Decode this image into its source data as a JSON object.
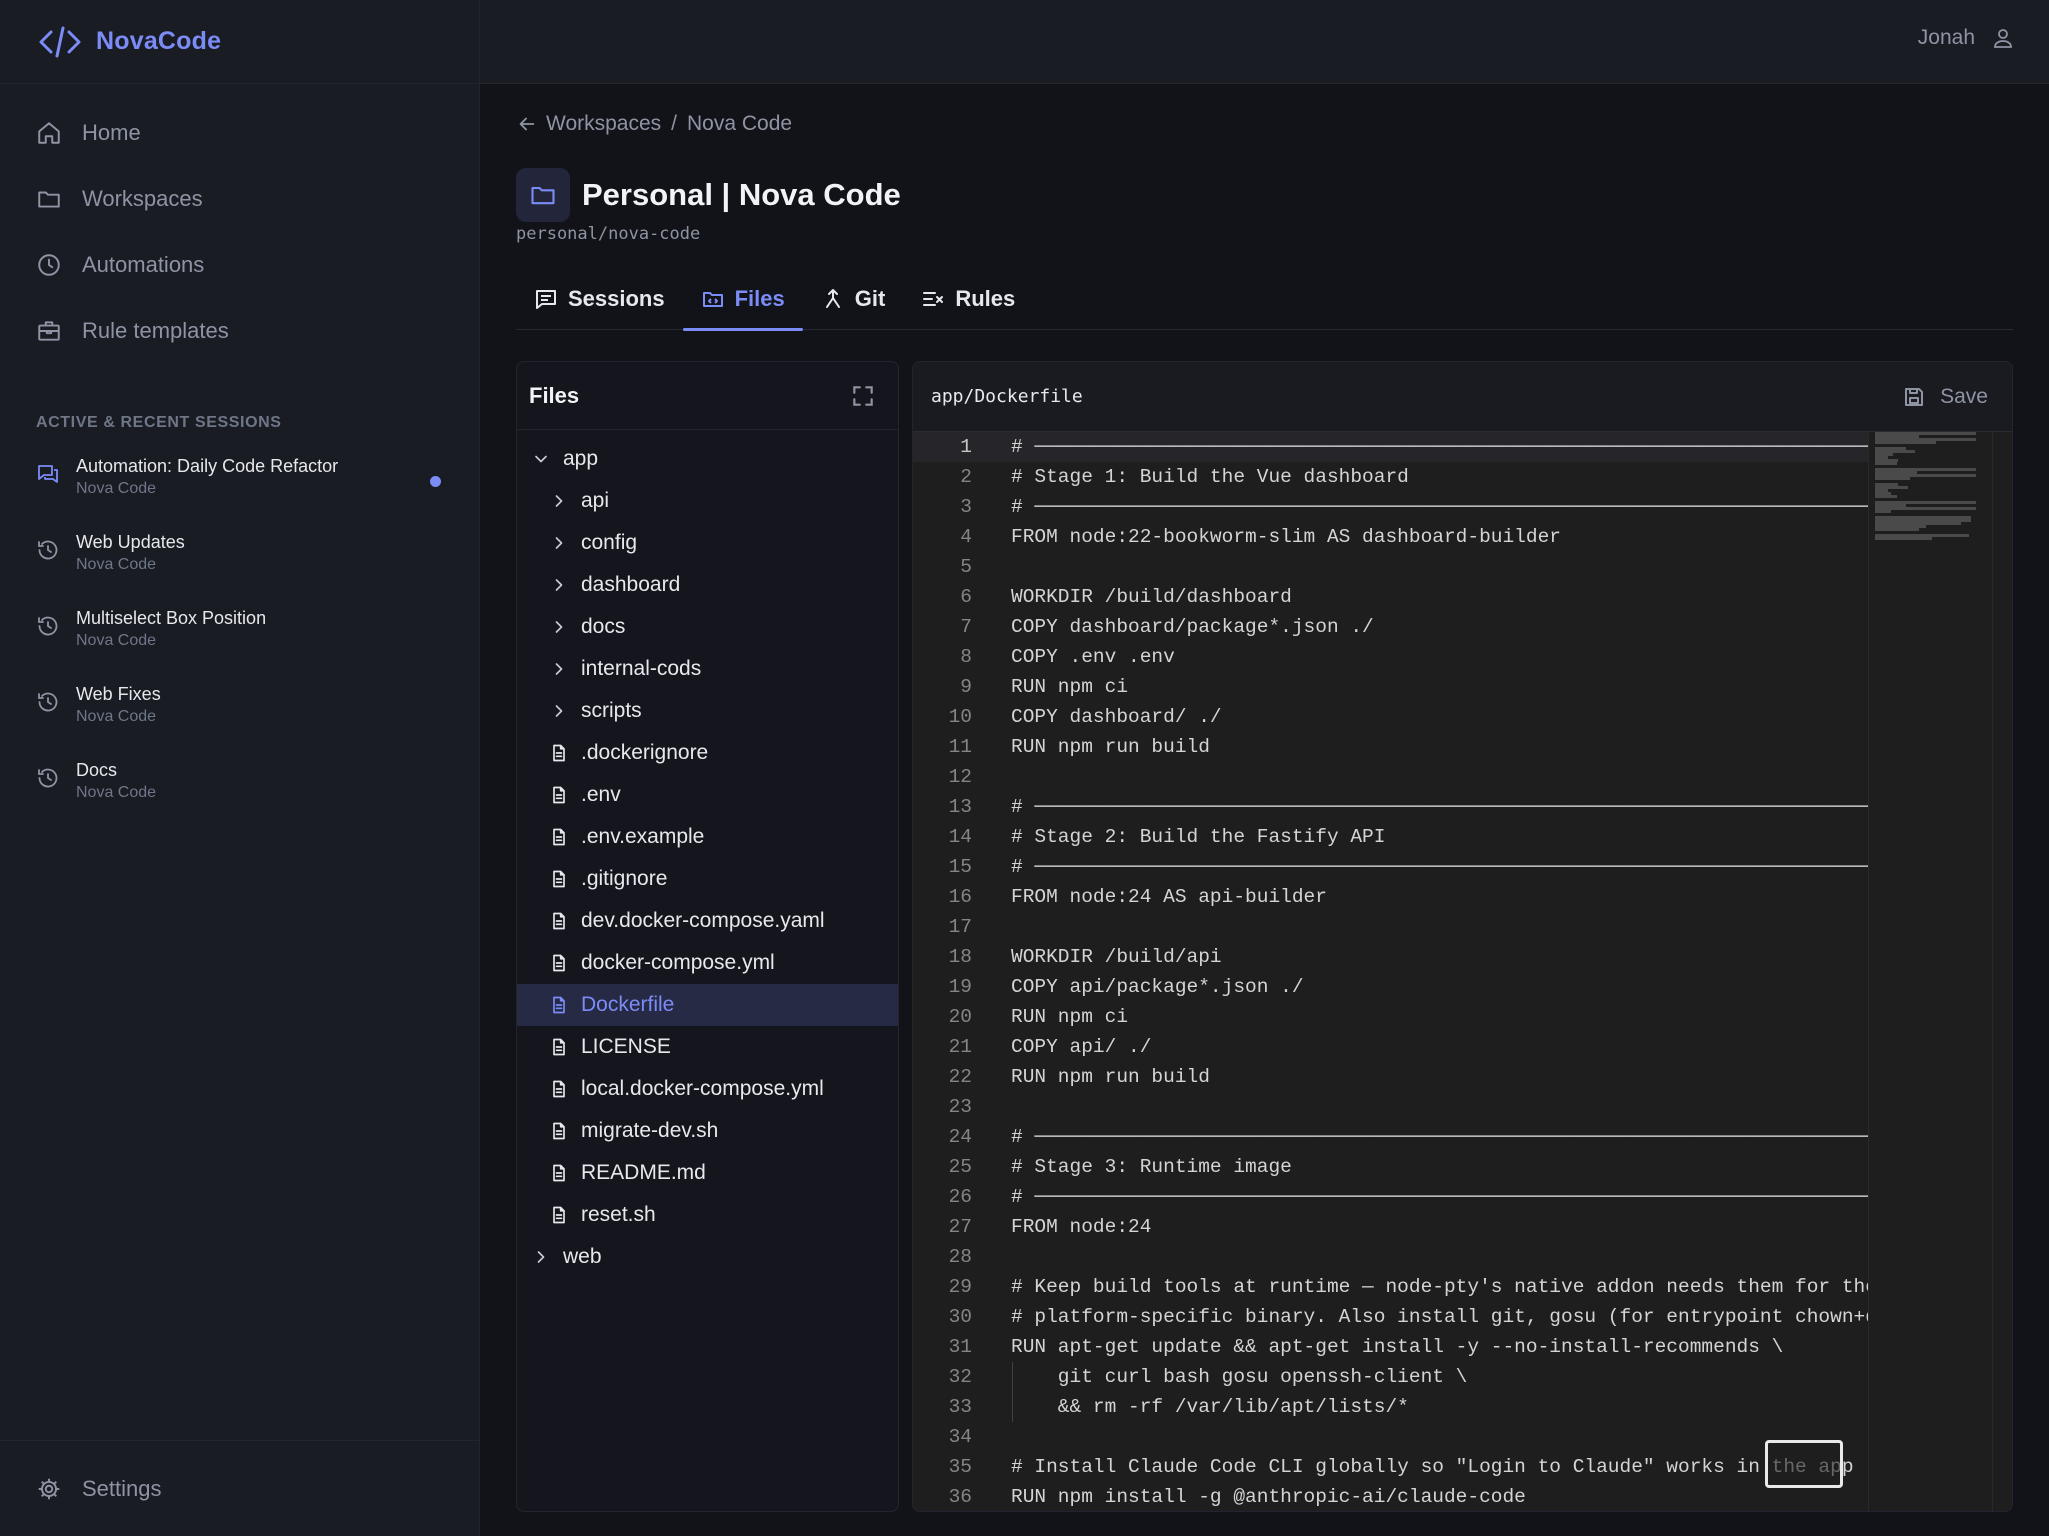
{
  "app": {
    "name": "NovaCode"
  },
  "sidebar": {
    "nav": [
      {
        "label": "Home",
        "icon": "home-icon"
      },
      {
        "label": "Workspaces",
        "icon": "folder-icon"
      },
      {
        "label": "Automations",
        "icon": "clock-icon"
      },
      {
        "label": "Rule templates",
        "icon": "briefcase-icon"
      }
    ],
    "sessions_label": "ACTIVE & RECENT SESSIONS",
    "sessions": [
      {
        "title": "Automation: Daily Code Refactor",
        "sub": "Nova Code",
        "icon": "chat-icon",
        "active": true
      },
      {
        "title": "Web Updates",
        "sub": "Nova Code",
        "icon": "history-icon"
      },
      {
        "title": "Multiselect Box Position",
        "sub": "Nova Code",
        "icon": "history-icon"
      },
      {
        "title": "Web Fixes",
        "sub": "Nova Code",
        "icon": "history-icon"
      },
      {
        "title": "Docs",
        "sub": "Nova Code",
        "icon": "history-icon"
      }
    ],
    "settings_label": "Settings"
  },
  "topbar": {
    "user_name": "Jonah"
  },
  "breadcrumb": {
    "parent": "Workspaces",
    "separator": "/",
    "current": "Nova Code"
  },
  "page": {
    "title": "Personal | Nova Code",
    "slug": "personal/nova-code"
  },
  "tabs": [
    {
      "label": "Sessions",
      "icon": "message-icon"
    },
    {
      "label": "Files",
      "icon": "folder-code-icon",
      "active": true
    },
    {
      "label": "Git",
      "icon": "git-merge-icon"
    },
    {
      "label": "Rules",
      "icon": "list-check-icon"
    }
  ],
  "files": {
    "title": "Files",
    "tree": [
      {
        "name": "app",
        "type": "folder-open",
        "level": 0
      },
      {
        "name": "api",
        "type": "folder",
        "level": 1
      },
      {
        "name": "config",
        "type": "folder",
        "level": 1
      },
      {
        "name": "dashboard",
        "type": "folder",
        "level": 1
      },
      {
        "name": "docs",
        "type": "folder",
        "level": 1
      },
      {
        "name": "internal-cods",
        "type": "folder",
        "level": 1
      },
      {
        "name": "scripts",
        "type": "folder",
        "level": 1
      },
      {
        "name": ".dockerignore",
        "type": "file",
        "level": 1
      },
      {
        "name": ".env",
        "type": "file",
        "level": 1
      },
      {
        "name": ".env.example",
        "type": "file",
        "level": 1
      },
      {
        "name": ".gitignore",
        "type": "file",
        "level": 1
      },
      {
        "name": "dev.docker-compose.yaml",
        "type": "file",
        "level": 1
      },
      {
        "name": "docker-compose.yml",
        "type": "file",
        "level": 1
      },
      {
        "name": "Dockerfile",
        "type": "file",
        "level": 1,
        "selected": true
      },
      {
        "name": "LICENSE",
        "type": "file",
        "level": 1
      },
      {
        "name": "local.docker-compose.yml",
        "type": "file",
        "level": 1
      },
      {
        "name": "migrate-dev.sh",
        "type": "file",
        "level": 1
      },
      {
        "name": "README.md",
        "type": "file",
        "level": 1
      },
      {
        "name": "reset.sh",
        "type": "file",
        "level": 1
      },
      {
        "name": "web",
        "type": "folder",
        "level": 0
      }
    ]
  },
  "editor": {
    "path": "app/Dockerfile",
    "save_label": "Save",
    "current_line": 1,
    "lines": [
      "# ────────────────────────────────────────────────────────────────────────────",
      "# Stage 1: Build the Vue dashboard",
      "# ────────────────────────────────────────────────────────────────────────────",
      "FROM node:22-bookworm-slim AS dashboard-builder",
      "",
      "WORKDIR /build/dashboard",
      "COPY dashboard/package*.json ./",
      "COPY .env .env",
      "RUN npm ci",
      "COPY dashboard/ ./",
      "RUN npm run build",
      "",
      "# ────────────────────────────────────────────────────────────────────────────",
      "# Stage 2: Build the Fastify API",
      "# ────────────────────────────────────────────────────────────────────────────",
      "FROM node:24 AS api-builder",
      "",
      "WORKDIR /build/api",
      "COPY api/package*.json ./",
      "RUN npm ci",
      "COPY api/ ./",
      "RUN npm run build",
      "",
      "# ────────────────────────────────────────────────────────────────────────────",
      "# Stage 3: Runtime image",
      "# ────────────────────────────────────────────────────────────────────────────",
      "FROM node:24",
      "",
      "# Keep build tools at runtime — node-pty's native addon needs them for the",
      "# platform-specific binary. Also install git, gosu (for entrypoint chown+d",
      "RUN apt-get update && apt-get install -y --no-install-recommends \\",
      "    git curl bash gosu openssh-client \\",
      "    && rm -rf /var/lib/apt/lists/*",
      "",
      "# Install Claude Code CLI globally so \"Login to Claude\" works in the app",
      "RUN npm install -g @anthropic-ai/claude-code"
    ]
  },
  "colors": {
    "accent": "#7b8cf7",
    "sidebar_bg": "#1a1c24",
    "main_bg": "#121318",
    "editor_bg": "#1e1e1e"
  }
}
